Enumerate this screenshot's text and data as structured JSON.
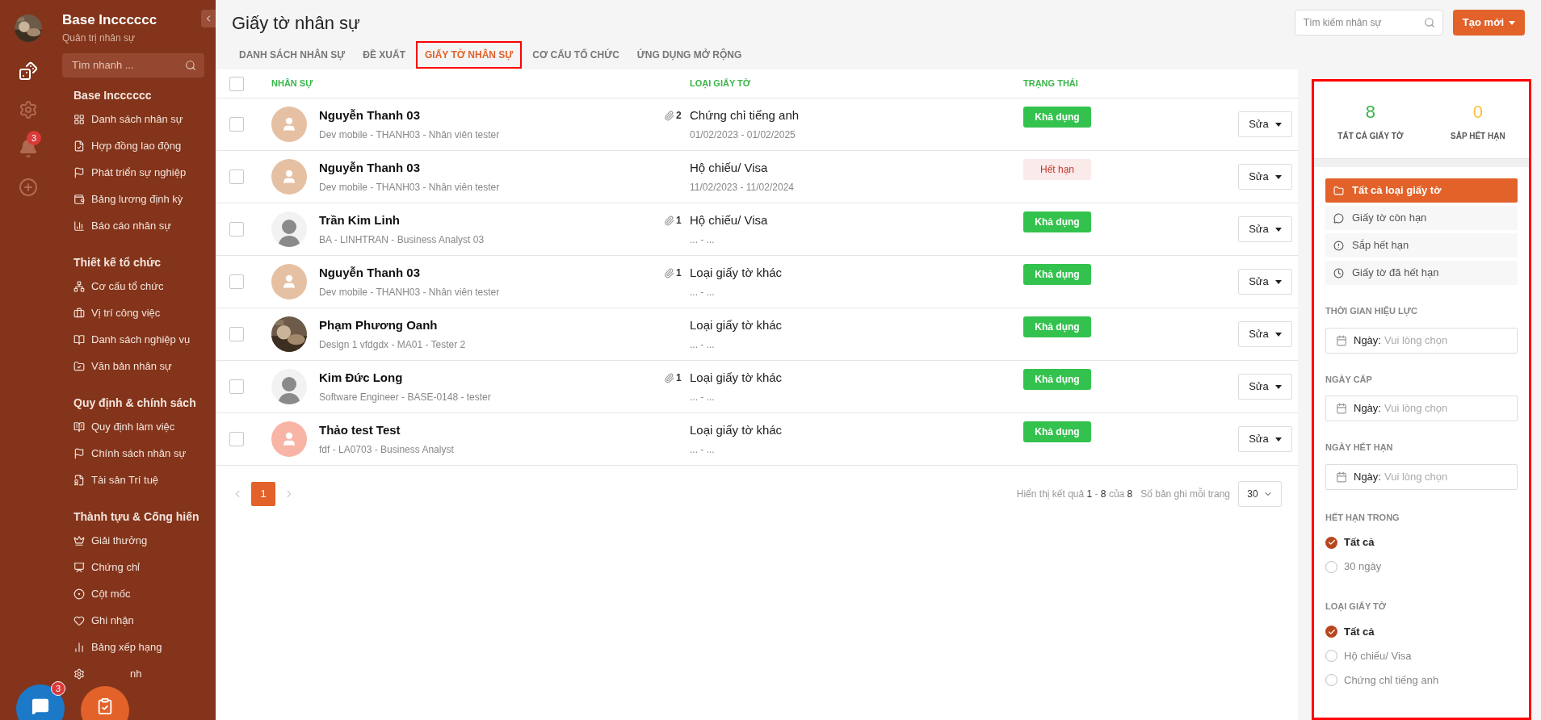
{
  "rail": {
    "badge": "3"
  },
  "sidebar": {
    "title": "Base Incccccc",
    "subtitle": "Quản trị nhân sự",
    "search": {
      "placeholder": "Tìm nhanh ..."
    },
    "groups": [
      {
        "title": "Base Incccccc",
        "items": [
          "Danh sách nhân sự",
          "Hợp đồng lao động",
          "Phát triển sự nghiệp",
          "Bảng lương định kỳ",
          "Báo cáo nhân sự"
        ]
      },
      {
        "title": "Thiết kế tổ chức",
        "items": [
          "Cơ cấu tổ chức",
          "Vị trí công việc",
          "Danh sách nghiệp vụ",
          "Văn bản nhân sự"
        ]
      },
      {
        "title": "Quy định & chính sách",
        "items": [
          "Quy định làm việc",
          "Chính sách nhân sự",
          "Tài sản Trí tuệ"
        ]
      },
      {
        "title": "Thành tựu & Cống hiến",
        "items": [
          "Giải thưởng",
          "Chứng chỉ",
          "Cột mốc",
          "Ghi nhận",
          "Bảng xếp hạng",
          "nh"
        ]
      }
    ]
  },
  "chat": {
    "badge": "3"
  },
  "header": {
    "title": "Giấy tờ nhân sự",
    "search": {
      "placeholder": "Tìm kiếm nhân sự"
    },
    "create_button": "Tạo mới"
  },
  "tabs": [
    {
      "label": "DANH SÁCH NHÂN SỰ",
      "selected": false
    },
    {
      "label": "ĐỀ XUẤT",
      "selected": false
    },
    {
      "label": "GIẤY TỜ NHÂN SỰ",
      "selected": true
    },
    {
      "label": "CƠ CẤU TỔ CHỨC",
      "selected": false
    },
    {
      "label": "ỨNG DỤNG MỞ RỘNG",
      "selected": false
    }
  ],
  "table": {
    "select_all_checked": false,
    "columns": [
      "NHÂN SỰ",
      "LOẠI GIẤY TỜ",
      "TRẠNG THÁI"
    ],
    "rows": [
      {
        "checked": false,
        "avatar": {
          "kind": "default",
          "color": "#e6c0a3"
        },
        "name": "Nguyễn Thanh 03",
        "detail": "Dev mobile - THANH03 - Nhân viên tester",
        "attachments": "2",
        "doc_type": "Chứng chỉ tiếng anh",
        "dates": "01/02/2023 - 01/02/2025",
        "status": {
          "kind": "active",
          "label": "Khả dụng"
        },
        "action": "Sửa"
      },
      {
        "checked": false,
        "avatar": {
          "kind": "default",
          "color": "#e6c0a3"
        },
        "name": "Nguyễn Thanh 03",
        "detail": "Dev mobile - THANH03 - Nhân viên tester",
        "doc_type": "Hộ chiếu/ Visa",
        "dates": "11/02/2023 - 11/02/2024",
        "status": {
          "kind": "expired",
          "label": "Hết hạn"
        },
        "action": "Sửa"
      },
      {
        "checked": false,
        "avatar": {
          "kind": "silhouette"
        },
        "name": "Trần Kim Linh",
        "detail": "BA - LINHTRAN - Business Analyst 03",
        "attachments": "1",
        "doc_type": "Hộ chiếu/ Visa",
        "dates": "... - ...",
        "status": {
          "kind": "active",
          "label": "Khả dụng"
        },
        "action": "Sửa"
      },
      {
        "checked": false,
        "avatar": {
          "kind": "default",
          "color": "#e6c0a3"
        },
        "name": "Nguyễn Thanh 03",
        "detail": "Dev mobile - THANH03 - Nhân viên tester",
        "attachments": "1",
        "doc_type": "Loại giấy tờ khác",
        "dates": "... - ...",
        "status": {
          "kind": "active",
          "label": "Khả dụng"
        },
        "action": "Sửa"
      },
      {
        "checked": false,
        "name": "Phạm Phương Oanh",
        "detail": "Design 1 vfdgdx - MA01 - Tester 2",
        "doc_type": "Loại giấy tờ khác",
        "dates": "... - ...",
        "status": {
          "kind": "active",
          "label": "Khả dụng"
        },
        "action": "Sửa"
      },
      {
        "checked": false,
        "avatar": {
          "kind": "silhouette"
        },
        "name": "Kim Đức Long",
        "detail": "Software Engineer - BASE-0148 - tester",
        "attachments": "1",
        "doc_type": "Loại giấy tờ khác",
        "dates": "... - ...",
        "status": {
          "kind": "active",
          "label": "Khả dụng"
        },
        "action": "Sửa"
      },
      {
        "checked": false,
        "avatar": {
          "kind": "default",
          "color": "#f8b4a5"
        },
        "name": "Thảo test Test",
        "detail": "fdf - LA0703 - Business Analyst",
        "doc_type": "Loại giấy tờ khác",
        "dates": "... - ...",
        "status": {
          "kind": "active",
          "label": "Khả dụng"
        },
        "action": "Sửa"
      }
    ]
  },
  "pagination": {
    "pages": [
      {
        "label": "1",
        "selected": true
      }
    ],
    "summary": "Hiển thị kết quả **1** - **8** của **8**",
    "per_page_label": "Số bản ghi mỗi trang",
    "per_page": "30"
  },
  "panel": {
    "stats": [
      {
        "value": "8",
        "label": "TẤT CẢ GIẤY TỜ",
        "color": "#3ab54a"
      },
      {
        "value": "0",
        "label": "SẮP HẾT HẠN",
        "color": "#f9c23c"
      }
    ],
    "filters": [
      {
        "label": "Tất cả loại giấy tờ",
        "selected": true
      },
      {
        "label": "Giấy tờ còn hạn",
        "selected": false
      },
      {
        "label": "Sắp hết hạn",
        "selected": false
      },
      {
        "label": "Giấy tờ đã hết hạn",
        "selected": false
      }
    ],
    "date_filters": [
      {
        "title": "THỜI GIAN HIỆU LỰC",
        "prefix": "Ngày:",
        "placeholder": "Vui lòng chọn"
      },
      {
        "title": "NGÀY CẤP",
        "prefix": "Ngày:",
        "placeholder": "Vui lòng chọn"
      },
      {
        "title": "NGÀY HẾT HẠN",
        "prefix": "Ngày:",
        "placeholder": "Vui lòng chọn"
      }
    ],
    "radio_groups": [
      {
        "title": "HẾT HẠN TRONG",
        "options": [
          {
            "label": "Tất cả",
            "selected": true
          },
          {
            "label": "30 ngày",
            "selected": false
          }
        ]
      },
      {
        "title": "LOẠI GIẤY TỜ",
        "options": [
          {
            "label": "Tất cả",
            "selected": true
          },
          {
            "label": "Hộ chiếu/ Visa",
            "selected": false
          },
          {
            "label": "Chứng chỉ tiếng anh",
            "selected": false
          }
        ]
      }
    ]
  }
}
